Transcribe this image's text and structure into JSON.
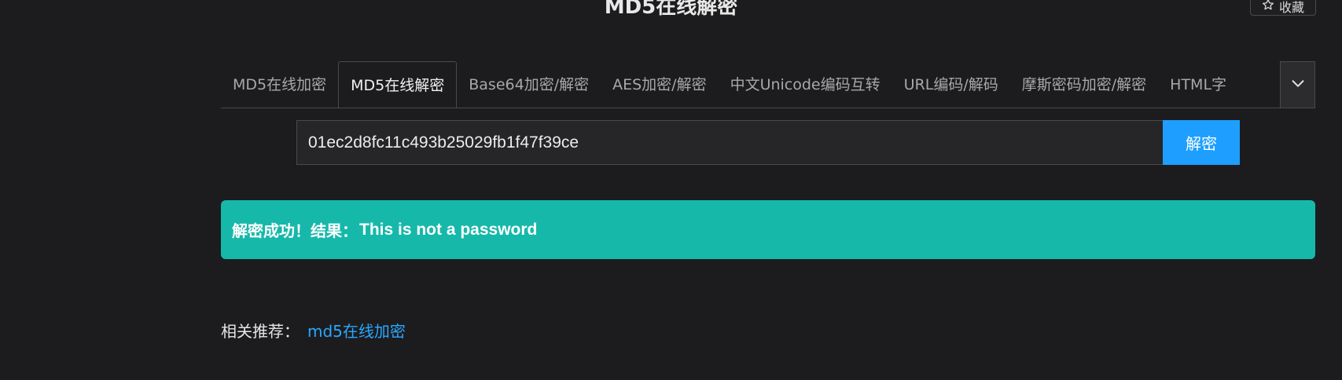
{
  "header": {
    "title": "MD5在线解密",
    "favorite_label": "收藏",
    "favorite_icon": "star-icon"
  },
  "tabs": [
    {
      "label": "MD5在线加密",
      "active": false
    },
    {
      "label": "MD5在线解密",
      "active": true
    },
    {
      "label": "Base64加密/解密",
      "active": false
    },
    {
      "label": "AES加密/解密",
      "active": false
    },
    {
      "label": "中文Unicode编码互转",
      "active": false
    },
    {
      "label": "URL编码/解码",
      "active": false
    },
    {
      "label": "摩斯密码加密/解密",
      "active": false
    },
    {
      "label": "HTML字",
      "active": false
    }
  ],
  "tabs_toggle_icon": "chevron-down-icon",
  "form": {
    "input_value": "01ec2d8fc11c493b25029fb1f47f39ce",
    "submit_label": "解密"
  },
  "result": {
    "prefix": "解密成功！结果：",
    "value": "This is not a password"
  },
  "related": {
    "label": "相关推荐：",
    "link_text": "md5在线加密"
  },
  "colors": {
    "background": "#1c1c1e",
    "primary_button": "#1e9fff",
    "success": "#16b8aa",
    "link": "#2aa7ff"
  }
}
